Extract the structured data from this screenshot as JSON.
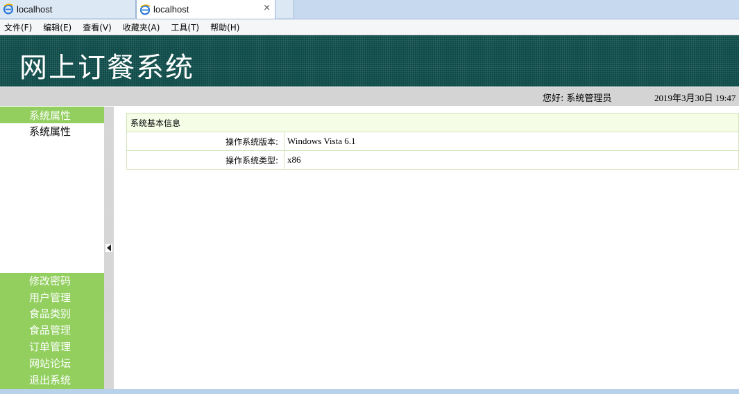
{
  "browser": {
    "tabs": [
      {
        "label": "localhost",
        "icon": "ie-icon",
        "active": false
      },
      {
        "label": "localhost",
        "icon": "ie-icon",
        "active": true,
        "close": "×"
      }
    ]
  },
  "menu": [
    "文件(F)",
    "编辑(E)",
    "查看(V)",
    "收藏夹(A)",
    "工具(T)",
    "帮助(H)"
  ],
  "header": {
    "title": "网上订餐系统",
    "greeting_label": "您好:",
    "user": "系统管理员",
    "datetime": "2019年3月30日 19:47"
  },
  "sidebar": {
    "section_title": "系统属性",
    "section_item": "系统属性",
    "items": [
      "修改密码",
      "用户管理",
      "食品类别",
      "食品管理",
      "订单管理",
      "网站论坛",
      "退出系统"
    ]
  },
  "main": {
    "table_title": "系统基本信息",
    "rows": [
      {
        "label": "操作系统版本:",
        "value": "Windows Vista  6.1"
      },
      {
        "label": "操作系统类型:",
        "value": "x86"
      }
    ]
  },
  "colors": {
    "banner": "#0d4a48",
    "sidebar_green": "#92cf5f",
    "table_border": "#d3e3b8",
    "table_header_bg": "#f6fde7"
  }
}
